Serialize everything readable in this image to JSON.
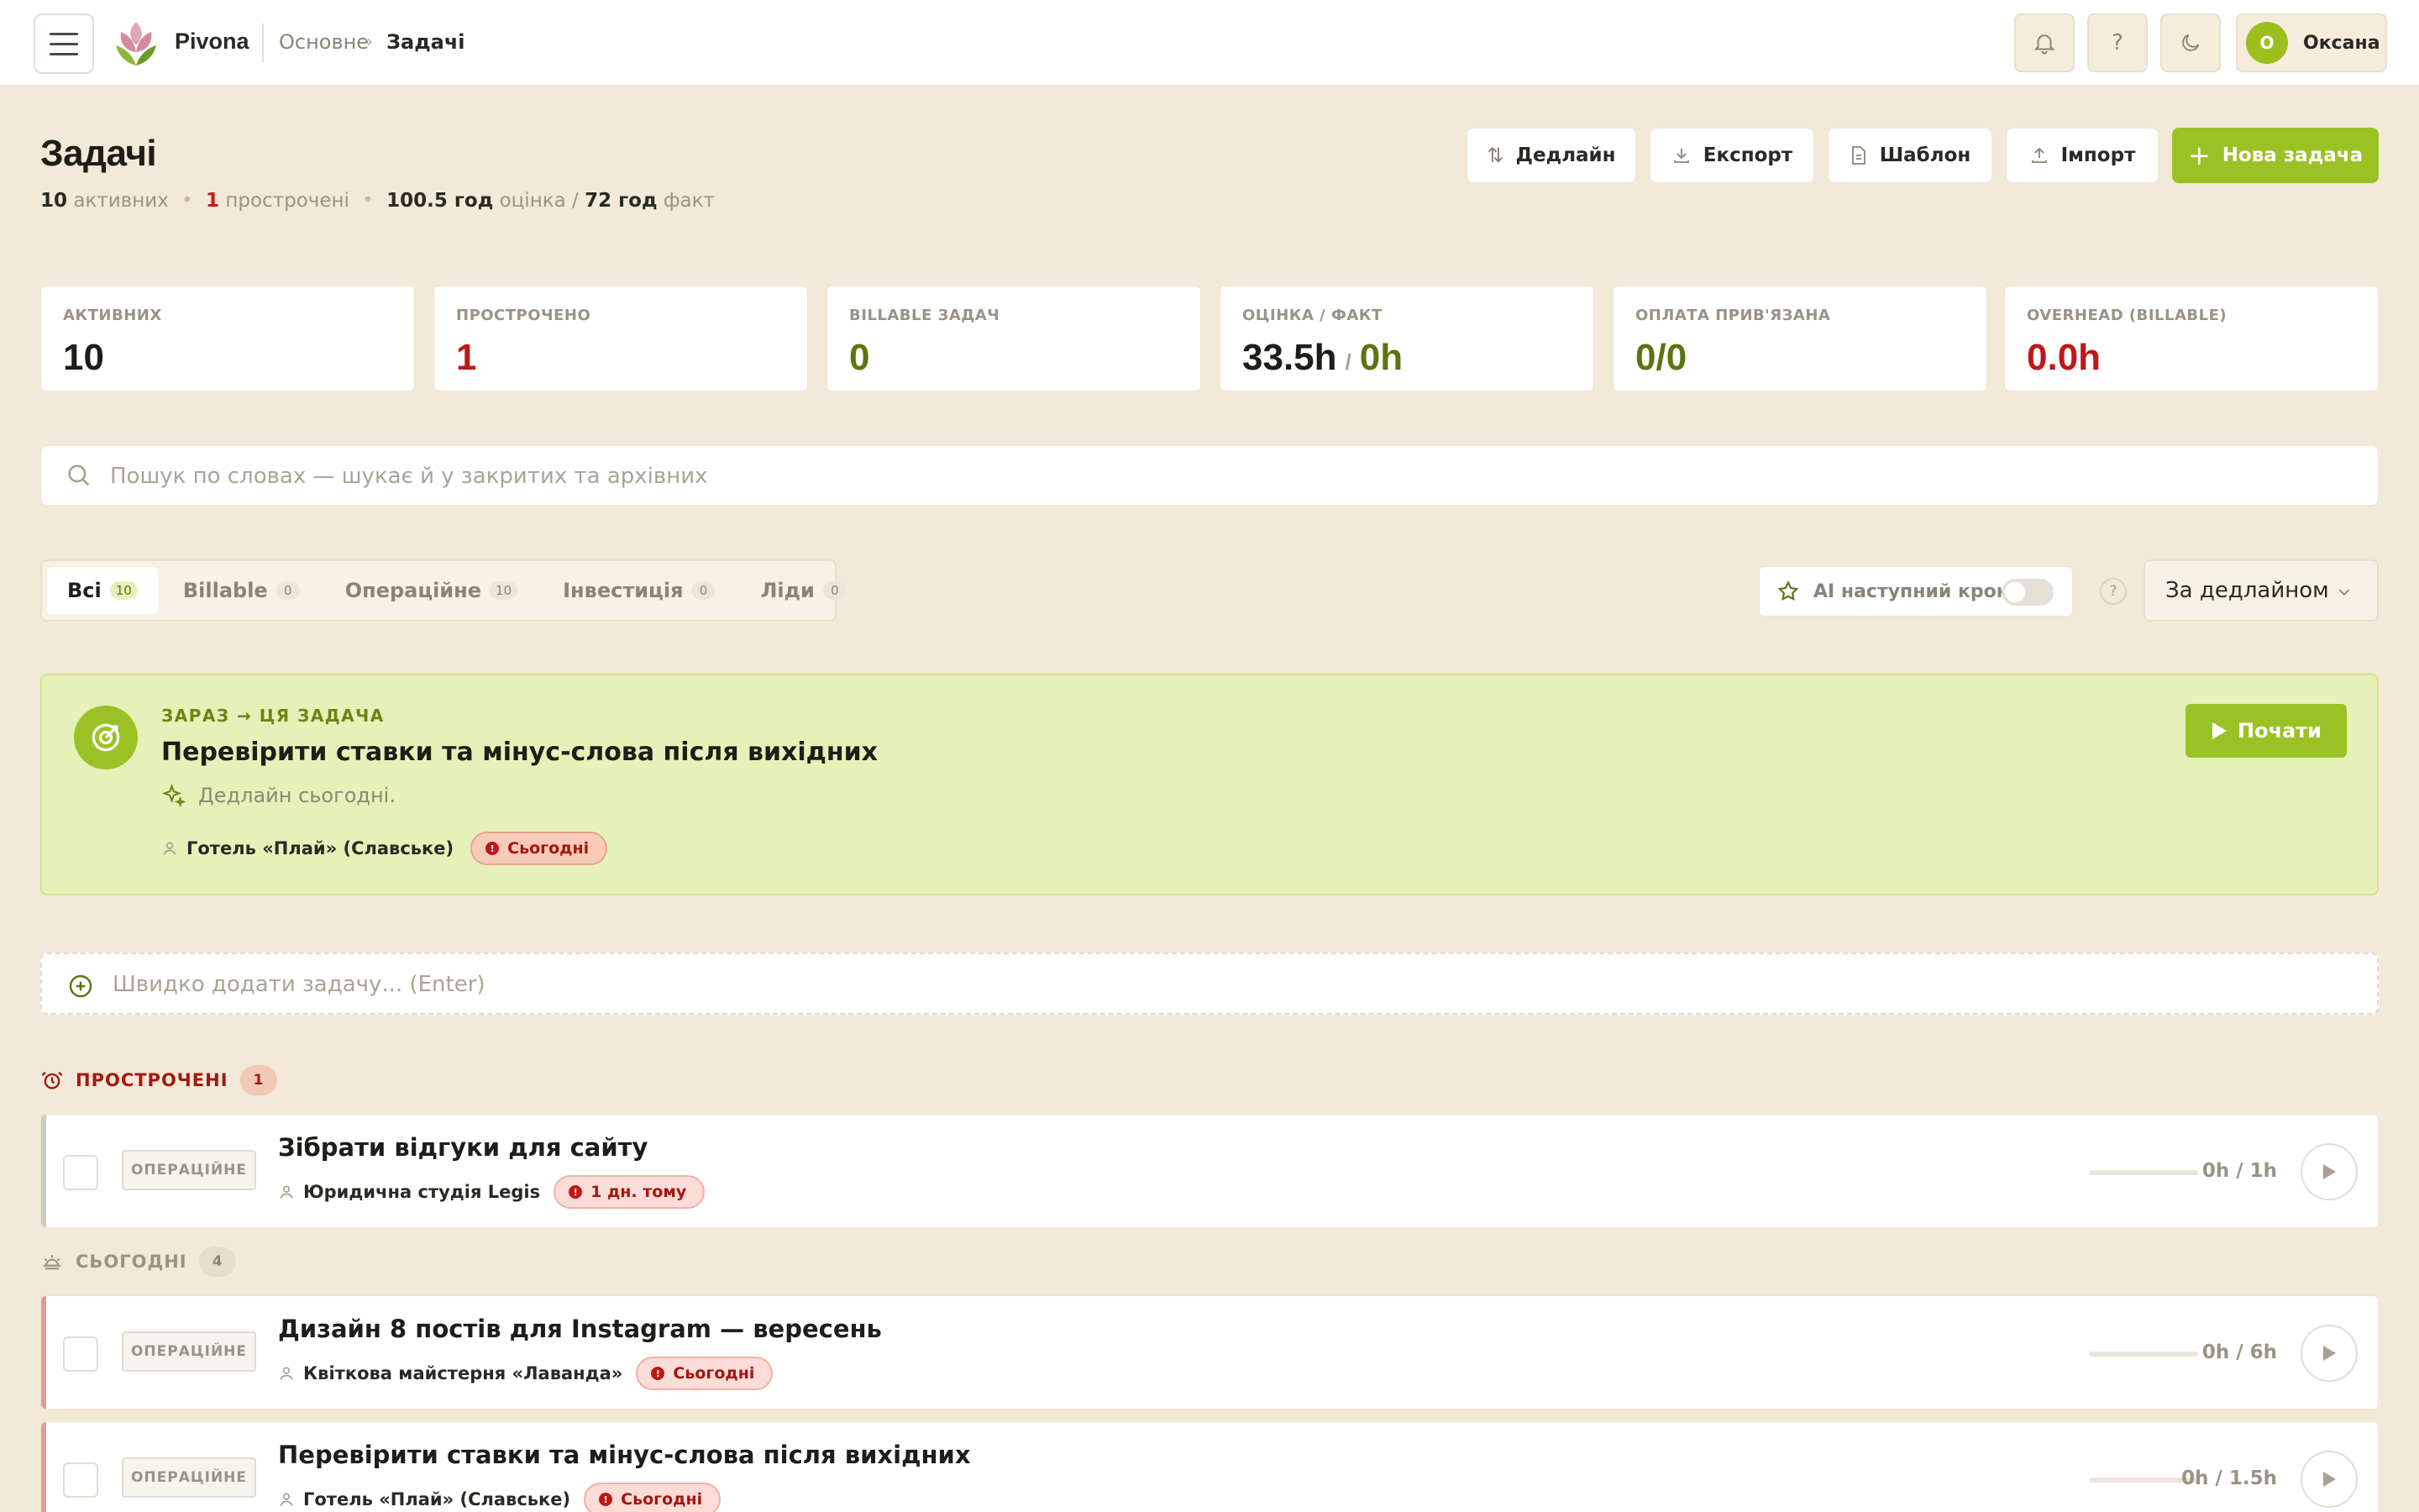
{
  "app": {
    "brand": "Pivona"
  },
  "breadcrumb": {
    "root": "Основне",
    "separator": "›",
    "current": "Задачі"
  },
  "header_icons": {
    "notifications": "bell-icon",
    "help": "?",
    "theme": "moon-icon"
  },
  "user": {
    "initial": "О",
    "name": "Оксана"
  },
  "page": {
    "title": "Задачі",
    "summary": {
      "active_count": "10",
      "active_label": "активних",
      "overdue_count": "1",
      "overdue_label": "прострочені",
      "estimate": "100.5 год",
      "estimate_label": "оцінка /",
      "fact": "72 год",
      "fact_label": "факт"
    }
  },
  "actions": {
    "deadline": "Дедлайн",
    "export": "Експорт",
    "template": "Шаблон",
    "import": "Імпорт",
    "new_task": "Нова задача"
  },
  "stats": [
    {
      "label": "АКТИВНИХ",
      "value": "10"
    },
    {
      "label": "ПРОСТРОЧЕНО",
      "value": "1"
    },
    {
      "label": "BILLABLE ЗАДАЧ",
      "value": "0"
    },
    {
      "label": "ОЦІНКА / ФАКТ",
      "value": "33.5h",
      "value2": "0h",
      "sep": "/"
    },
    {
      "label": "ОПЛАТА ПРИВ'ЯЗАНА",
      "value": "0/0"
    },
    {
      "label": "OVERHEAD (BILLABLE)",
      "value": "0.0h"
    }
  ],
  "search": {
    "placeholder": "Пошук по словах — шукає й у закритих та архівних"
  },
  "tabs": [
    {
      "label": "Всі",
      "count": "10",
      "active": true
    },
    {
      "label": "Billable",
      "count": "0"
    },
    {
      "label": "Операційне",
      "count": "10"
    },
    {
      "label": "Інвестиція",
      "count": "0"
    },
    {
      "label": "Ліди",
      "count": "0"
    }
  ],
  "ai_toggle": {
    "label": "AI наступний крок",
    "on": false
  },
  "help_small": "?",
  "sort": {
    "selected": "За дедлайном"
  },
  "focus": {
    "kicker": "ЗАРАЗ → ЦЯ ЗАДАЧА",
    "title": "Перевірити ставки та мінус-слова після вихідних",
    "description": "Дедлайн сьогодні.",
    "client": "Готель «Плай» (Славське)",
    "due": "Сьогодні",
    "start_label": "Почати"
  },
  "quick_add": {
    "placeholder": "Швидко додати задачу... (Enter)"
  },
  "groups": {
    "overdue": {
      "label": "ПРОСТРОЧЕНІ",
      "count": "1"
    },
    "today": {
      "label": "СЬОГОДНІ",
      "count": "4"
    }
  },
  "tasks": [
    {
      "type": "ОПЕРАЦІЙНЕ",
      "title": "Зібрати відгуки для сайту",
      "client": "Юридична студія Legis",
      "due": "1 дн. тому",
      "hours": "0h / 1h",
      "progress": 0
    },
    {
      "type": "ОПЕРАЦІЙНЕ",
      "title": "Дизайн 8 постів для Instagram — вересень",
      "client": "Квіткова майстерня «Лаванда»",
      "due": "Сьогодні",
      "hours": "0h / 6h",
      "progress": 0
    },
    {
      "type": "ОПЕРАЦІЙНЕ",
      "title": "Перевірити ставки та мінус-слова після вихідних",
      "client": "Готель «Плай» (Славське)",
      "due": "Сьогодні",
      "hours": "0h / 1.5h",
      "progress": 0
    }
  ],
  "colors": {
    "accent": "#9ac224",
    "overdue": "#c01717",
    "background": "#f2e9d8",
    "today_bar": "#e39a9a",
    "overdue_bar": "#cfcac0"
  }
}
